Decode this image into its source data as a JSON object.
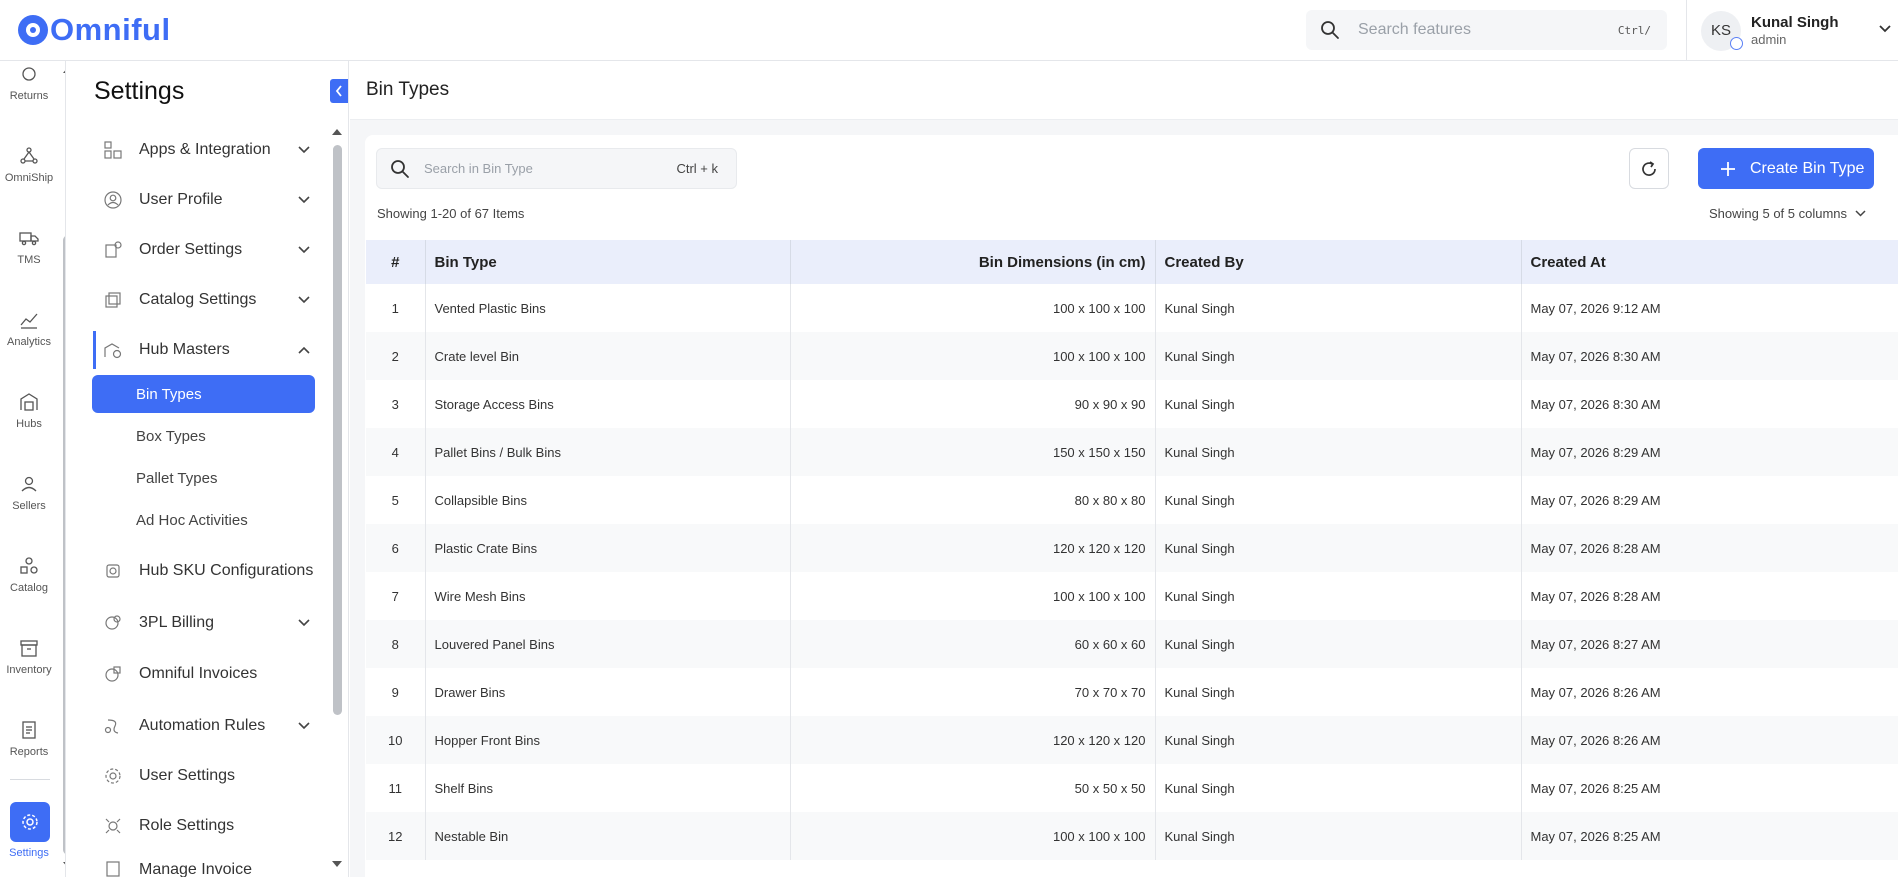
{
  "app": {
    "brand": "Omniful"
  },
  "topbar": {
    "search_placeholder": "Search features",
    "search_shortcut": "Ctrl/",
    "user": {
      "initials": "KS",
      "name": "Kunal Singh",
      "role": "admin"
    }
  },
  "rail": {
    "items": [
      {
        "label": "Returns",
        "icon": "returns-icon"
      },
      {
        "label": "OmniShip",
        "icon": "omniship-icon"
      },
      {
        "label": "TMS",
        "icon": "truck-icon"
      },
      {
        "label": "Analytics",
        "icon": "analytics-icon"
      },
      {
        "label": "Hubs",
        "icon": "hub-icon"
      },
      {
        "label": "Sellers",
        "icon": "user-icon"
      },
      {
        "label": "Catalog",
        "icon": "catalog-icon"
      },
      {
        "label": "Inventory",
        "icon": "inventory-icon"
      },
      {
        "label": "Reports",
        "icon": "reports-icon"
      }
    ],
    "active": {
      "label": "Settings",
      "icon": "gear-icon"
    }
  },
  "settings": {
    "title": "Settings",
    "menu": [
      {
        "label": "Apps & Integration",
        "chevron": "down"
      },
      {
        "label": "User Profile",
        "chevron": "down"
      },
      {
        "label": "Order Settings",
        "chevron": "down"
      },
      {
        "label": "Catalog Settings",
        "chevron": "down"
      },
      {
        "label": "Hub Masters",
        "chevron": "up"
      },
      {
        "label": "Hub SKU Configurations",
        "chevron": ""
      },
      {
        "label": "3PL Billing",
        "chevron": "down"
      },
      {
        "label": "Omniful Invoices",
        "chevron": ""
      },
      {
        "label": "Automation Rules",
        "chevron": "down"
      },
      {
        "label": "User Settings",
        "chevron": ""
      },
      {
        "label": "Role Settings",
        "chevron": ""
      },
      {
        "label": "Manage Invoice",
        "chevron": ""
      }
    ],
    "submenu": [
      {
        "label": "Bin Types",
        "active": true
      },
      {
        "label": "Box Types"
      },
      {
        "label": "Pallet Types"
      },
      {
        "label": "Ad Hoc Activities"
      }
    ]
  },
  "page": {
    "title": "Bin Types",
    "search_placeholder": "Search in Bin Type",
    "search_shortcut": "Ctrl + k",
    "create_label": "Create Bin Type",
    "showing_items": "Showing 1-20 of 67 Items",
    "showing_columns": "Showing 5 of 5 columns"
  },
  "table": {
    "columns": [
      "#",
      "Bin Type",
      "Bin Dimensions (in cm)",
      "Created By",
      "Created At"
    ],
    "rows": [
      [
        "1",
        "Vented Plastic Bins",
        "100 x 100 x 100",
        "Kunal Singh",
        "May 07, 2026 9:12 AM"
      ],
      [
        "2",
        "Crate level Bin",
        "100 x 100 x 100",
        "Kunal Singh",
        "May 07, 2026 8:30 AM"
      ],
      [
        "3",
        "Storage Access Bins",
        "90 x 90 x 90",
        "Kunal Singh",
        "May 07, 2026 8:30 AM"
      ],
      [
        "4",
        "Pallet Bins / Bulk Bins",
        "150 x 150 x 150",
        "Kunal Singh",
        "May 07, 2026 8:29 AM"
      ],
      [
        "5",
        "Collapsible Bins",
        "80 x 80 x 80",
        "Kunal Singh",
        "May 07, 2026 8:29 AM"
      ],
      [
        "6",
        "Plastic Crate Bins",
        "120 x 120 x 120",
        "Kunal Singh",
        "May 07, 2026 8:28 AM"
      ],
      [
        "7",
        "Wire Mesh Bins",
        "100 x 100 x 100",
        "Kunal Singh",
        "May 07, 2026 8:28 AM"
      ],
      [
        "8",
        "Louvered Panel Bins",
        "60 x 60 x 60",
        "Kunal Singh",
        "May 07, 2026 8:27 AM"
      ],
      [
        "9",
        "Drawer Bins",
        "70 x 70 x 70",
        "Kunal Singh",
        "May 07, 2026 8:26 AM"
      ],
      [
        "10",
        "Hopper Front Bins",
        "120 x 120 x 120",
        "Kunal Singh",
        "May 07, 2026 8:26 AM"
      ],
      [
        "11",
        "Shelf Bins",
        "50 x 50 x 50",
        "Kunal Singh",
        "May 07, 2026 8:25 AM"
      ],
      [
        "12",
        "Nestable Bin",
        "100 x 100 x 100",
        "Kunal Singh",
        "May 07, 2026 8:25 AM"
      ]
    ]
  },
  "colors": {
    "accent": "#3e6df5",
    "header_bg": "#eaeefb"
  }
}
